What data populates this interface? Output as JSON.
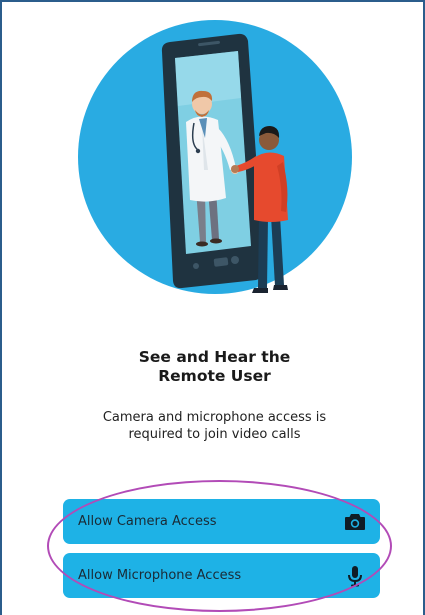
{
  "onboarding": {
    "title_line1": "See and Hear the",
    "title_line2": "Remote User",
    "description_line1": "Camera and microphone access is",
    "description_line2": "required to join video calls"
  },
  "buttons": {
    "camera_label": "Allow Camera Access",
    "camera_icon": "camera-icon",
    "microphone_label": "Allow Microphone Access",
    "microphone_icon": "microphone-icon"
  },
  "colors": {
    "accent": "#1eb2e6",
    "circle": "#29abe2",
    "highlight": "#b24bb7",
    "border": "#2b5d8c"
  }
}
